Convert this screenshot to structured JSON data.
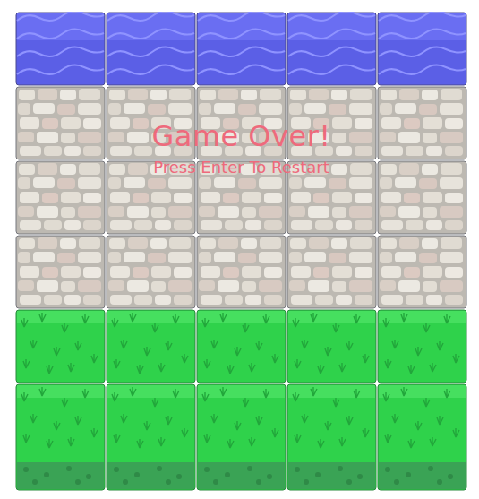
{
  "overlay": {
    "title": "Game Over!",
    "subtitle": "Press Enter To Restart"
  },
  "board": {
    "rows": [
      {
        "kind": "water",
        "count": 5
      },
      {
        "kind": "stone",
        "count": 5
      },
      {
        "kind": "stone",
        "count": 5
      },
      {
        "kind": "stone",
        "count": 5
      },
      {
        "kind": "grass",
        "count": 5
      },
      {
        "kind": "grass-edge",
        "count": 5
      }
    ]
  }
}
